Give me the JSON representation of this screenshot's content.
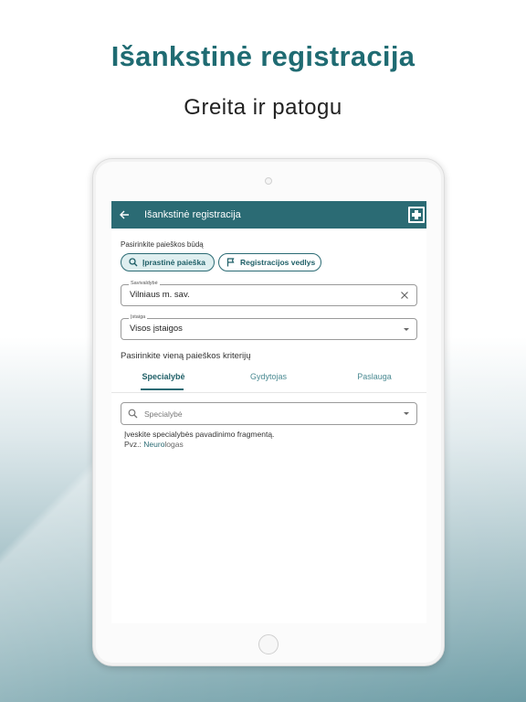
{
  "headline": "Išankstinė registracija",
  "subheadline": "Greita ir patogu",
  "app": {
    "title": "Išankstinė registracija",
    "search_mode_label": "Pasirinkite paieškos būdą",
    "chips": [
      {
        "label": "Įprastinė paieška",
        "icon": "search-icon",
        "selected": true
      },
      {
        "label": "Registracijos vedlys",
        "icon": "flag-icon",
        "selected": false
      }
    ],
    "municipality": {
      "label": "Savivaldybė",
      "value": "Vilniaus m. sav."
    },
    "institution": {
      "label": "Įstaiga",
      "value": "Visos įstaigos"
    },
    "criteria_title": "Pasirinkite vieną paieškos kriterijų",
    "tabs": [
      "Specialybė",
      "Gydytojas",
      "Paslauga"
    ],
    "active_tab": "Specialybė",
    "search": {
      "placeholder": "Specialybė"
    },
    "hint": "Įveskite specialybės pavadinimo fragmentą.",
    "example_prefix": "Pvz.: ",
    "example_highlight": "Neuro",
    "example_rest": "logas"
  },
  "colors": {
    "brand": "#2b6b74",
    "headline": "#1f6b72"
  }
}
